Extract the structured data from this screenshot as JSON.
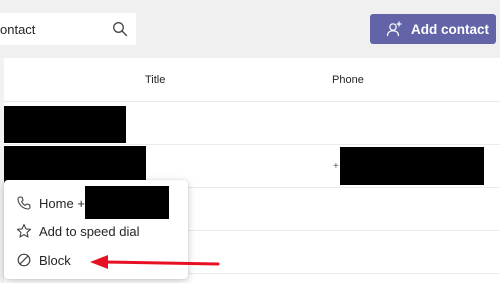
{
  "search": {
    "value": "ontact"
  },
  "header": {
    "add_contact_label": "Add contact"
  },
  "table": {
    "columns": {
      "title": "Title",
      "phone": "Phone"
    },
    "rows": [
      {
        "phone_prefix": ""
      },
      {
        "phone_prefix": "+"
      }
    ]
  },
  "context_menu": {
    "items": [
      {
        "label": "Home",
        "suffix": "+",
        "icon": "phone-icon"
      },
      {
        "label": "Add to speed dial",
        "icon": "star-icon"
      },
      {
        "label": "Block",
        "icon": "block-icon"
      }
    ]
  },
  "colors": {
    "accent": "#6264a7",
    "annotation_arrow": "#e81123"
  }
}
